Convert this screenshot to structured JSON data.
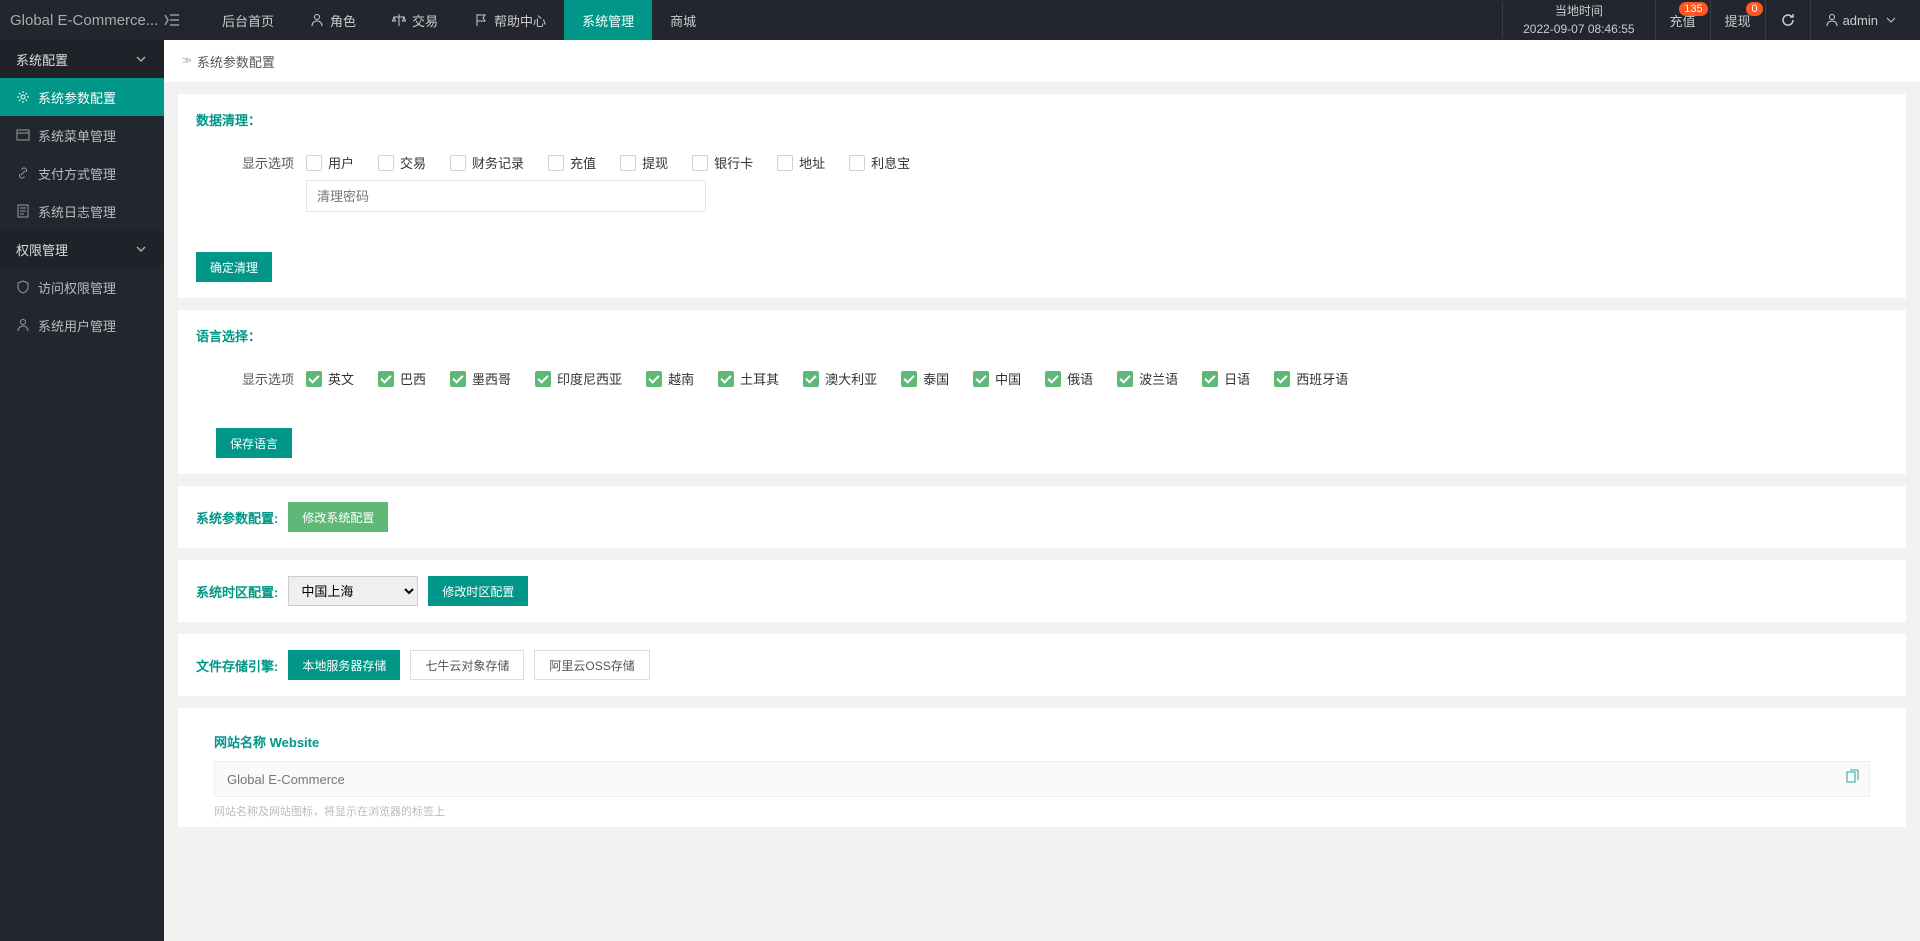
{
  "brand": "Global E-Commerce...",
  "topnav": [
    {
      "label": "后台首页"
    },
    {
      "label": "角色"
    },
    {
      "label": "交易"
    },
    {
      "label": "帮助中心"
    },
    {
      "label": "系统管理"
    },
    {
      "label": "商城"
    }
  ],
  "time": {
    "label": "当地时间",
    "value": "2022-09-07 08:46:55"
  },
  "right": {
    "recharge": {
      "label": "充值",
      "badge": "135"
    },
    "withdraw": {
      "label": "提现",
      "badge": "0"
    },
    "user": "admin"
  },
  "sidebar": {
    "group1": "系统配置",
    "items1": [
      {
        "label": "系统参数配置"
      },
      {
        "label": "系统菜单管理"
      },
      {
        "label": "支付方式管理"
      },
      {
        "label": "系统日志管理"
      }
    ],
    "group2": "权限管理",
    "items2": [
      {
        "label": "访问权限管理"
      },
      {
        "label": "系统用户管理"
      }
    ]
  },
  "breadcrumb": "系统参数配置",
  "section_data_clean": {
    "title": "数据清理：",
    "row_label": "显示选项",
    "options": [
      "用户",
      "交易",
      "财务记录",
      "充值",
      "提现",
      "银行卡",
      "地址",
      "利息宝"
    ],
    "pwd_placeholder": "清理密码",
    "btn": "确定清理"
  },
  "section_lang": {
    "title": "语言选择：",
    "row_label": "显示选项",
    "options": [
      "英文",
      "巴西",
      "墨西哥",
      "印度尼西亚",
      "越南",
      "土耳其",
      "澳大利亚",
      "泰国",
      "中国",
      "俄语",
      "波兰语",
      "日语",
      "西班牙语"
    ],
    "btn": "保存语言"
  },
  "section_sysparam": {
    "title": "系统参数配置:",
    "btn": "修改系统配置"
  },
  "section_tz": {
    "title": "系统时区配置:",
    "option": "中国上海",
    "btn": "修改时区配置"
  },
  "section_storage": {
    "title": "文件存储引擎:",
    "options": [
      "本地服务器存储",
      "七牛云对象存储",
      "阿里云OSS存储"
    ]
  },
  "section_site": {
    "heading": "网站名称 Website",
    "value": "Global E-Commerce",
    "helper": "网站名称及网站图标，将显示在浏览器的标签上"
  }
}
